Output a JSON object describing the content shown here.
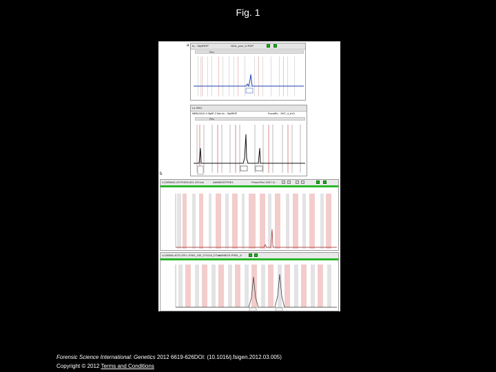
{
  "page": {
    "title": "Fig. 1"
  },
  "figure": {
    "panel_a_label": "a",
    "panel_b_label": "b",
    "top_window": {
      "title_left": "ls... Sty9RHP",
      "title_right": "NDA_pool_el RDP",
      "subbar": "Plex"
    },
    "second_window": {
      "title_left": "Ls 2691",
      "subtitle_left": "MEBL0GLE 4 Sty9E 3 Diet-4x... Sty9RHP",
      "subtitle_right": "FoundRx... 2007_4_sl:01",
      "subbar": "Plex"
    },
    "third_window": {
      "title_left": "LCARMNS-20TPHEN 821 223.lns",
      "title_mid": "AMNBG5TPHE1",
      "title_right": "PrimerFlex 2007.11 ."
    },
    "fourth_window": {
      "title_left": "LCARMA-4070-2PLL-FINH_230_071018_DTnx",
      "title_mid": "AMNBGS-PRBL_8"
    }
  },
  "footer": {
    "journal": "Forensic Science International: Genetics",
    "citation": "2012 6619-626DOI: (10.1016/j.fsigen.2012.03.005)",
    "copyright": "Copyright © 2012",
    "terms_link": "Terms and Conditions"
  },
  "colors": {
    "background": "#000000",
    "bin_gray": "#d9d9d9",
    "bin_pink": "#f0c2c2",
    "peak_blue": "#1c3fae",
    "peak_red": "#b03030",
    "accent_green": "#1cb31c"
  }
}
